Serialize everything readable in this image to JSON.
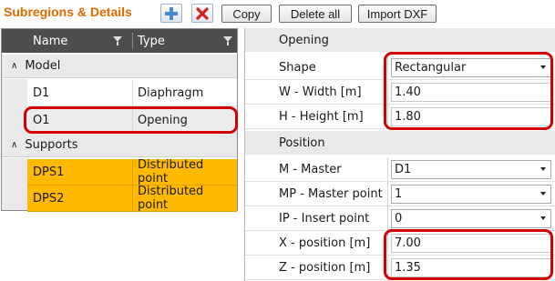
{
  "header": {
    "title": "Subregions & Details",
    "buttons": {
      "copy": "Copy",
      "delete_all": "Delete all",
      "import_dxf": "Import DXF"
    }
  },
  "grid": {
    "columns": {
      "name": "Name",
      "type": "Type"
    },
    "groups": [
      {
        "label": "Model",
        "rows": [
          {
            "name": "D1",
            "type": "Diaphragm"
          },
          {
            "name": "O1",
            "type": "Opening"
          }
        ]
      },
      {
        "label": "Supports",
        "rows": [
          {
            "name": "DPS1",
            "type": "Distributed point"
          },
          {
            "name": "DPS2",
            "type": "Distributed point"
          }
        ]
      }
    ]
  },
  "properties": {
    "opening": {
      "title": "Opening",
      "shape_label": "Shape",
      "shape_value": "Rectangular",
      "width_label": "W - Width [m]",
      "width_value": "1.40",
      "height_label": "H - Height [m]",
      "height_value": "1.80"
    },
    "position": {
      "title": "Position",
      "master_label": "M - Master",
      "master_value": "D1",
      "master_point_label": "MP - Master point",
      "master_point_value": "1",
      "insert_point_label": "IP - Insert point",
      "insert_point_value": "0",
      "x_label": "X - position [m]",
      "x_value": "7.00",
      "z_label": "Z - position [m]",
      "z_value": "1.35"
    }
  },
  "colors": {
    "accent": "#e06a00",
    "highlight": "#d40000",
    "selected_row": "#ffb900",
    "header": "#4d4d4d"
  }
}
